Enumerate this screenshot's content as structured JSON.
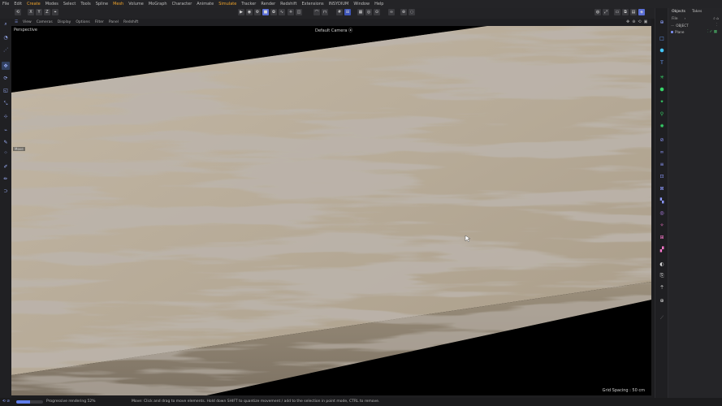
{
  "menu": [
    {
      "label": "File",
      "highlight": false
    },
    {
      "label": "Edit",
      "highlight": false
    },
    {
      "label": "Create",
      "highlight": true
    },
    {
      "label": "Modes",
      "highlight": false
    },
    {
      "label": "Select",
      "highlight": false
    },
    {
      "label": "Tools",
      "highlight": false
    },
    {
      "label": "Spline",
      "highlight": false
    },
    {
      "label": "Mesh",
      "highlight": true
    },
    {
      "label": "Volume",
      "highlight": false
    },
    {
      "label": "MoGraph",
      "highlight": false
    },
    {
      "label": "Character",
      "highlight": false
    },
    {
      "label": "Animate",
      "highlight": false
    },
    {
      "label": "Simulate",
      "highlight": true
    },
    {
      "label": "Tracker",
      "highlight": false
    },
    {
      "label": "Render",
      "highlight": false
    },
    {
      "label": "Redshift",
      "highlight": false
    },
    {
      "label": "Extensions",
      "highlight": false
    },
    {
      "label": "INSYDIUM",
      "highlight": false
    },
    {
      "label": "Window",
      "highlight": false
    },
    {
      "label": "Help",
      "highlight": false
    }
  ],
  "viewport_menu": [
    "View",
    "Cameras",
    "Display",
    "Options",
    "Filter",
    "Panel",
    "Redshift"
  ],
  "viewport": {
    "projection": "Perspective",
    "camera": "Default Camera ⦿",
    "grid_spacing": "Grid Spacing : 50 cm",
    "overlay_label": "Move"
  },
  "object_manager": {
    "tabs": [
      "Objects",
      "Takes"
    ],
    "menu": [
      "File",
      "›"
    ],
    "rows": [
      {
        "label": "OBJECT"
      },
      {
        "label": "Plane"
      }
    ]
  },
  "status": {
    "progress_label": "Progressive rendering 52%",
    "progress_fraction": 0.52,
    "hint": "Move: Click and drag to move elements. Hold down SHIFT to quantize movement / add to the selection in point mode, CTRL to remove."
  },
  "colors": {
    "accent": "#5b6fd6",
    "menu_highlight": "#f0a42a",
    "wood_light": "#b8ab98",
    "wood_dark": "#8a7e6d"
  }
}
